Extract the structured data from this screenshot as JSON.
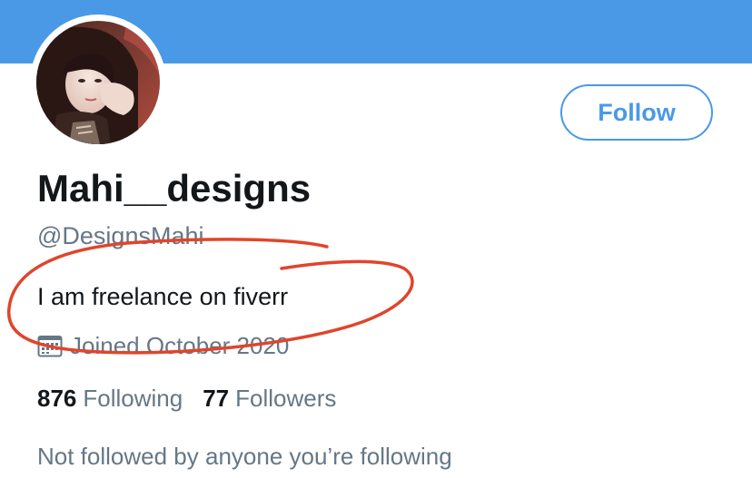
{
  "profile": {
    "display_name": "Mahi__designs",
    "handle": "@DesignsMahi",
    "bio": "I am freelance on fiverr",
    "joined": "Joined October 2020",
    "following_count": "876",
    "following_label": "Following",
    "followers_count": "77",
    "followers_label": "Followers",
    "mutual_note": "Not followed by anyone you’re following"
  },
  "actions": {
    "follow_label": "Follow"
  },
  "icons": {
    "joined": "calendar-icon",
    "avatar": "profile-photo"
  },
  "colors": {
    "banner": "#4a99e6",
    "accent": "#4a99e6",
    "secondary_text": "#657786",
    "primary_text": "#14171a",
    "annotation": "#e0452b"
  }
}
